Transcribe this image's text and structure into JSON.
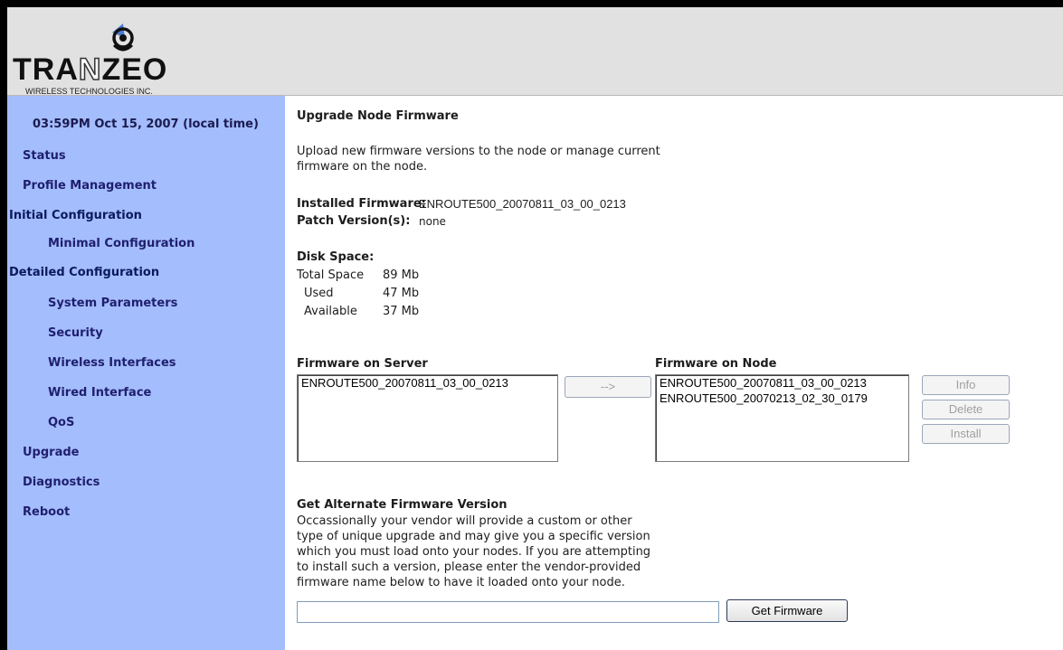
{
  "brand": {
    "name_part1": "TRA",
    "name_part2": "N",
    "name_part3": "ZEO",
    "tagline": "WIRELESS TECHNOLOGIES INC."
  },
  "sidebar": {
    "clock": "03:59PM Oct 15, 2007 (local time)",
    "items": [
      {
        "label": "Status"
      },
      {
        "label": "Profile Management"
      },
      {
        "label": "Initial Configuration"
      },
      {
        "label": "Minimal Configuration"
      },
      {
        "label": "Detailed Configuration"
      },
      {
        "label": "System Parameters"
      },
      {
        "label": "Security"
      },
      {
        "label": "Wireless Interfaces"
      },
      {
        "label": "Wired Interface"
      },
      {
        "label": "QoS"
      },
      {
        "label": "Upgrade"
      },
      {
        "label": "Diagnostics"
      },
      {
        "label": "Reboot"
      }
    ]
  },
  "main": {
    "title": "Upgrade Node Firmware",
    "intro_line1": "Upload new firmware versions to the node or manage current",
    "intro_line2": "firmware on the node.",
    "installed_label": "Installed Firmware:",
    "installed_value": "ENROUTE500_20070811_03_00_0213",
    "patch_label": "Patch Version(s):",
    "patch_value": "none",
    "disk_title": "Disk Space:",
    "disk": {
      "total_label": "Total Space",
      "total_value": "89 Mb",
      "used_label": "Used",
      "used_value": "47 Mb",
      "avail_label": "Available",
      "avail_value": "37 Mb"
    },
    "server_title": "Firmware on Server",
    "server_items": [
      "ENROUTE500_20070811_03_00_0213"
    ],
    "transfer_label": "-->",
    "node_title": "Firmware on Node",
    "node_items": [
      "ENROUTE500_20070811_03_00_0213",
      "ENROUTE500_20070213_02_30_0179"
    ],
    "info_label": "Info",
    "delete_label": "Delete",
    "install_label": "Install",
    "alt_title": "Get Alternate Firmware Version",
    "alt_lines": [
      "Occassionally your vendor will provide a custom or other",
      "type of unique upgrade and may give you a specific version",
      "which you must load onto your nodes. If you are attempting",
      "to install such a version, please enter the vendor-provided",
      "firmware name below to have it loaded onto your node."
    ],
    "alt_input_value": "",
    "get_button": "Get Firmware"
  }
}
